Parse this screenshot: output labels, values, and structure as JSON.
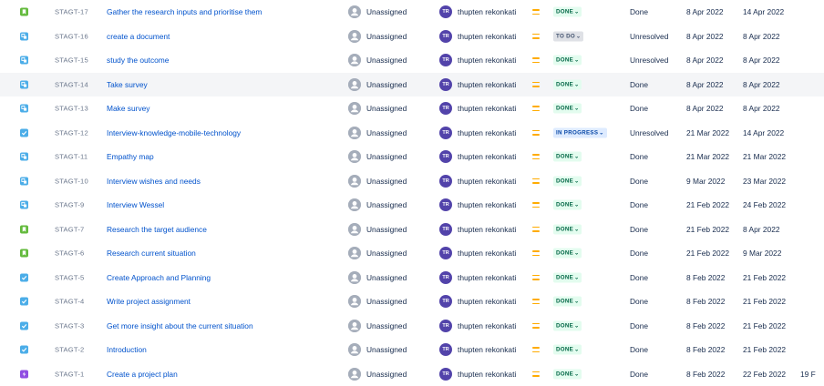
{
  "colors": {
    "story": "#63ba3c",
    "task": "#4bade8",
    "subtask": "#4bade8",
    "epic": "#904ee2",
    "link": "#0052cc",
    "done_bg": "#e3fcef",
    "progress_bg": "#deebff",
    "todo_bg": "#dfe1e6"
  },
  "rows": [
    {
      "type": "story",
      "type_icon": "bookmark-icon",
      "key": "STAGT-17",
      "summary": "Gather the research inputs and prioritise them",
      "assignee": "Unassigned",
      "reporter_initials": "TR",
      "reporter": "thupten rekonkati",
      "priority": "medium",
      "status": "DONE",
      "status_kind": "done",
      "resolution": "Done",
      "created": "8 Apr 2022",
      "updated": "14 Apr 2022"
    },
    {
      "type": "subtask",
      "type_icon": "subtask-icon",
      "key": "STAGT-16",
      "summary": "create a document",
      "assignee": "Unassigned",
      "reporter_initials": "TR",
      "reporter": "thupten rekonkati",
      "priority": "medium",
      "status": "TO DO",
      "status_kind": "todo",
      "resolution": "Unresolved",
      "created": "8 Apr 2022",
      "updated": "8 Apr 2022"
    },
    {
      "type": "subtask",
      "type_icon": "subtask-icon",
      "key": "STAGT-15",
      "summary": "study the outcome",
      "assignee": "Unassigned",
      "reporter_initials": "TR",
      "reporter": "thupten rekonkati",
      "priority": "medium",
      "status": "DONE",
      "status_kind": "done",
      "resolution": "Unresolved",
      "created": "8 Apr 2022",
      "updated": "8 Apr 2022"
    },
    {
      "type": "subtask",
      "type_icon": "subtask-icon",
      "key": "STAGT-14",
      "summary": "Take survey",
      "assignee": "Unassigned",
      "reporter_initials": "TR",
      "reporter": "thupten rekonkati",
      "priority": "medium",
      "status": "DONE",
      "status_kind": "done",
      "resolution": "Done",
      "created": "8 Apr 2022",
      "updated": "8 Apr 2022",
      "highlight": true
    },
    {
      "type": "subtask",
      "type_icon": "subtask-icon",
      "key": "STAGT-13",
      "summary": "Make survey",
      "assignee": "Unassigned",
      "reporter_initials": "TR",
      "reporter": "thupten rekonkati",
      "priority": "medium",
      "status": "DONE",
      "status_kind": "done",
      "resolution": "Done",
      "created": "8 Apr 2022",
      "updated": "8 Apr 2022"
    },
    {
      "type": "task",
      "type_icon": "checkbox-icon",
      "key": "STAGT-12",
      "summary": "Interview-knowledge-mobile-technology",
      "assignee": "Unassigned",
      "reporter_initials": "TR",
      "reporter": "thupten rekonkati",
      "priority": "medium",
      "status": "IN PROGRESS",
      "status_kind": "prog",
      "resolution": "Unresolved",
      "created": "21 Mar 2022",
      "updated": "14 Apr 2022"
    },
    {
      "type": "subtask",
      "type_icon": "subtask-icon",
      "key": "STAGT-11",
      "summary": "Empathy map",
      "assignee": "Unassigned",
      "reporter_initials": "TR",
      "reporter": "thupten rekonkati",
      "priority": "medium",
      "status": "DONE",
      "status_kind": "done",
      "resolution": "Done",
      "created": "21 Mar 2022",
      "updated": "21 Mar 2022"
    },
    {
      "type": "subtask",
      "type_icon": "subtask-icon",
      "key": "STAGT-10",
      "summary": "Interview wishes and needs",
      "assignee": "Unassigned",
      "reporter_initials": "TR",
      "reporter": "thupten rekonkati",
      "priority": "medium",
      "status": "DONE",
      "status_kind": "done",
      "resolution": "Done",
      "created": "9 Mar 2022",
      "updated": "23 Mar 2022"
    },
    {
      "type": "subtask",
      "type_icon": "subtask-icon",
      "key": "STAGT-9",
      "summary": "Interview Wessel",
      "assignee": "Unassigned",
      "reporter_initials": "TR",
      "reporter": "thupten rekonkati",
      "priority": "medium",
      "status": "DONE",
      "status_kind": "done",
      "resolution": "Done",
      "created": "21 Feb 2022",
      "updated": "24 Feb 2022"
    },
    {
      "type": "story",
      "type_icon": "bookmark-icon",
      "key": "STAGT-7",
      "summary": "Research the target audience",
      "assignee": "Unassigned",
      "reporter_initials": "TR",
      "reporter": "thupten rekonkati",
      "priority": "medium",
      "status": "DONE",
      "status_kind": "done",
      "resolution": "Done",
      "created": "21 Feb 2022",
      "updated": "8 Apr 2022"
    },
    {
      "type": "story",
      "type_icon": "bookmark-icon",
      "key": "STAGT-6",
      "summary": "Research current situation",
      "assignee": "Unassigned",
      "reporter_initials": "TR",
      "reporter": "thupten rekonkati",
      "priority": "medium",
      "status": "DONE",
      "status_kind": "done",
      "resolution": "Done",
      "created": "21 Feb 2022",
      "updated": "9 Mar 2022"
    },
    {
      "type": "task",
      "type_icon": "checkbox-icon",
      "key": "STAGT-5",
      "summary": "Create Approach and Planning",
      "assignee": "Unassigned",
      "reporter_initials": "TR",
      "reporter": "thupten rekonkati",
      "priority": "medium",
      "status": "DONE",
      "status_kind": "done",
      "resolution": "Done",
      "created": "8 Feb 2022",
      "updated": "21 Feb 2022"
    },
    {
      "type": "task",
      "type_icon": "checkbox-icon",
      "key": "STAGT-4",
      "summary": "Write project assignment",
      "assignee": "Unassigned",
      "reporter_initials": "TR",
      "reporter": "thupten rekonkati",
      "priority": "medium",
      "status": "DONE",
      "status_kind": "done",
      "resolution": "Done",
      "created": "8 Feb 2022",
      "updated": "21 Feb 2022"
    },
    {
      "type": "task",
      "type_icon": "checkbox-icon",
      "key": "STAGT-3",
      "summary": "Get more insight about the current situation",
      "assignee": "Unassigned",
      "reporter_initials": "TR",
      "reporter": "thupten rekonkati",
      "priority": "medium",
      "status": "DONE",
      "status_kind": "done",
      "resolution": "Done",
      "created": "8 Feb 2022",
      "updated": "21 Feb 2022"
    },
    {
      "type": "task",
      "type_icon": "checkbox-icon",
      "key": "STAGT-2",
      "summary": "Introduction",
      "assignee": "Unassigned",
      "reporter_initials": "TR",
      "reporter": "thupten rekonkati",
      "priority": "medium",
      "status": "DONE",
      "status_kind": "done",
      "resolution": "Done",
      "created": "8 Feb 2022",
      "updated": "21 Feb 2022"
    },
    {
      "type": "epic",
      "type_icon": "lightning-icon",
      "key": "STAGT-1",
      "summary": "Create a project plan",
      "assignee": "Unassigned",
      "reporter_initials": "TR",
      "reporter": "thupten rekonkati",
      "priority": "medium",
      "status": "DONE",
      "status_kind": "done",
      "resolution": "Done",
      "created": "8 Feb 2022",
      "updated": "22 Feb 2022",
      "extra": "19 F"
    }
  ]
}
